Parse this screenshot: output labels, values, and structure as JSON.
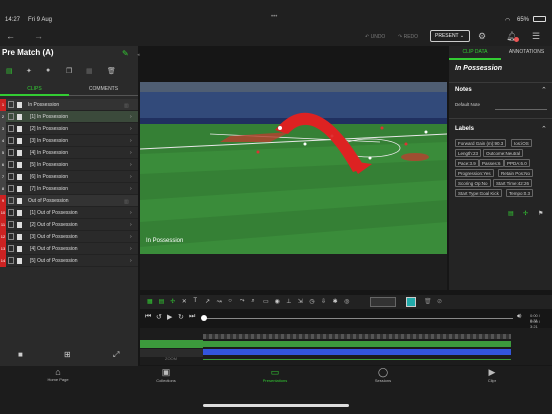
{
  "status": {
    "time": "14:27",
    "date": "Fri 9 Aug",
    "battery": "65%"
  },
  "nav": {
    "undo": "UNDO",
    "redo": "REDO",
    "present": "PRESENT"
  },
  "left": {
    "title": "Pre Match (A)",
    "tab_clips": "CLIPS",
    "tab_comments": "COMMENTS"
  },
  "clips": [
    {
      "num": "1",
      "label": "In Possession",
      "group": true,
      "color": "#c22"
    },
    {
      "num": "2",
      "label": "[1]  In Possession",
      "sel": true,
      "color": "#444"
    },
    {
      "num": "3",
      "label": "[2]  In Possession",
      "color": "#444"
    },
    {
      "num": "4",
      "label": "[3]  In Possession",
      "color": "#444"
    },
    {
      "num": "5",
      "label": "[4]  In Possession",
      "color": "#444"
    },
    {
      "num": "6",
      "label": "[5]  In Possession",
      "color": "#444"
    },
    {
      "num": "7",
      "label": "[6]  In Possession",
      "color": "#444"
    },
    {
      "num": "8",
      "label": "[7]  In Possession",
      "color": "#444"
    },
    {
      "num": "9",
      "label": "Out of Possession",
      "group": true,
      "color": "#c22"
    },
    {
      "num": "10",
      "label": "[1]  Out of Possession",
      "color": "#c22"
    },
    {
      "num": "11",
      "label": "[2]  Out of Possession",
      "color": "#c22"
    },
    {
      "num": "12",
      "label": "[3]  Out of Possession",
      "color": "#c22"
    },
    {
      "num": "13",
      "label": "[4]  Out of Possession",
      "color": "#c22"
    },
    {
      "num": "14",
      "label": "[5]  Out of Possession",
      "color": "#c22"
    }
  ],
  "video": {
    "caption": "In Possession"
  },
  "right": {
    "tab_clipdata": "CLIP DATA",
    "tab_annotations": "ANNOTATIONS",
    "clip_title": "In Possession",
    "notes_header": "Notes",
    "notes_label": "Default Note",
    "labels_header": "Labels",
    "labels": [
      "Forward Gain (m):90.3",
      "Ios:iOS",
      "Length:23",
      "Outcome:Neutral",
      "Pace:3.9",
      "Passes:6",
      "PPDA:6.0",
      "Progression:Yes",
      "Retain Pos:No",
      "Scoring Op:No",
      "Start Time:42:26",
      "Start Type:Goal Kick",
      "Tempo:0.3"
    ]
  },
  "timeline": {
    "time_top": "0:00 / 0:31",
    "time_bottom": "0:00 / 3:21",
    "zoom": "ZOOM",
    "colors": {
      "green": "#3c9a3c",
      "blue": "#3355dd"
    }
  },
  "bottom_tabs": [
    "Home Page",
    "Collections",
    "Presentations",
    "Sessions",
    "Clipr"
  ]
}
